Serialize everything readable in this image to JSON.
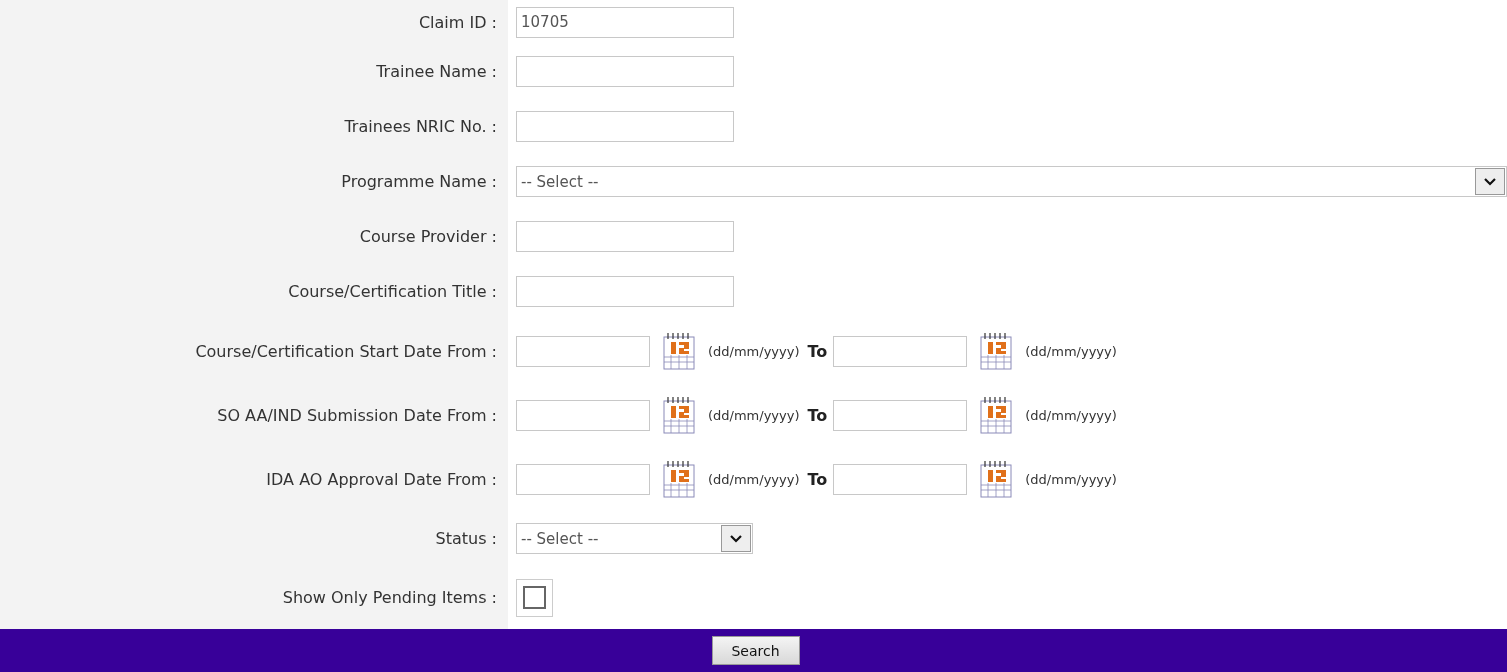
{
  "fields": [
    {
      "kind": "text",
      "label": "Claim ID :",
      "value": "10705"
    },
    {
      "kind": "text",
      "label": "Trainee Name :"
    },
    {
      "kind": "text",
      "label": "Trainees NRIC No. :"
    },
    {
      "kind": "select",
      "label": "Programme Name :",
      "value": "-- Select --",
      "wide": true
    },
    {
      "kind": "text",
      "label": "Course Provider :"
    },
    {
      "kind": "text",
      "label": "Course/Certification Title :"
    },
    {
      "kind": "date_range",
      "label": "Course/Certification Start Date From :",
      "from_hint": "(dd/mm/yyyy)",
      "to_label": "To",
      "to_hint": "(dd/mm/yyyy)"
    },
    {
      "kind": "date_range",
      "label": "SO AA/IND Submission Date From :",
      "from_hint": "(dd/mm/yyyy)",
      "to_label": "To",
      "to_hint": "(dd/mm/yyyy)"
    },
    {
      "kind": "date_range",
      "label": "IDA AO Approval Date From :",
      "from_hint": "(dd/mm/yyyy)",
      "to_label": "To",
      "to_hint": "(dd/mm/yyyy)"
    },
    {
      "kind": "select",
      "label": "Status :",
      "value": "-- Select --",
      "wide": false
    },
    {
      "kind": "checkbox",
      "label": "Show Only Pending Items :",
      "checked": false
    }
  ],
  "search_button": "Search"
}
